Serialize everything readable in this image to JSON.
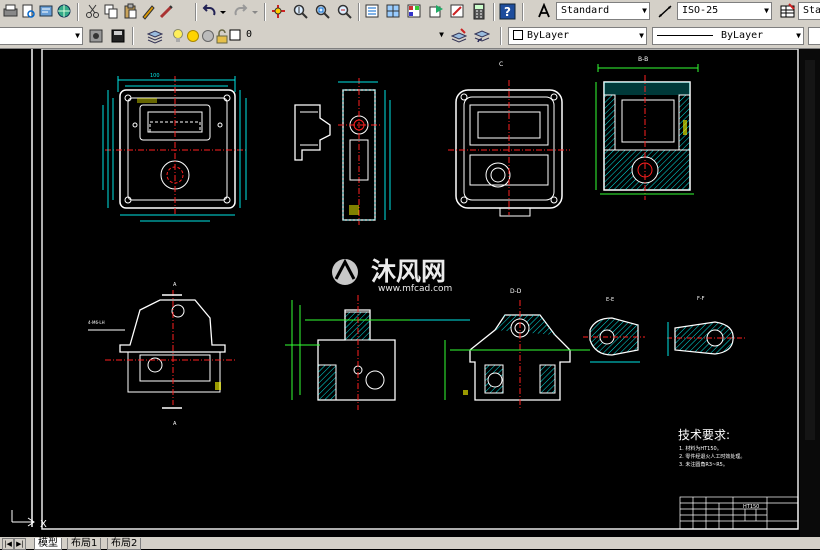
{
  "toolbar": {
    "text_style": "Standard",
    "dim_style": "ISO-25",
    "table_style_partial": "Sta"
  },
  "layers": {
    "current_layer": "0",
    "color": "ByLayer",
    "linetype": "ByLayer"
  },
  "drawing": {
    "views": {
      "top_right_label_c": "C",
      "top_right_label_bb": "B-B",
      "bottom_label_a_top": "A",
      "bottom_label_a_bottom": "A",
      "bottom_label_dd": "D-D",
      "bottom_label_ee": "E-E",
      "bottom_label_ff": "F-F",
      "hole_note": "4-M6-LH"
    },
    "watermark": {
      "brand": "沐风网",
      "url": "www.mfcad.com"
    },
    "tech_req": {
      "title": "技术要求:",
      "items": [
        "1. 材料为HT150。",
        "2. 零件经退火人工时效处理。",
        "3. 未注圆角R3~R5。"
      ]
    },
    "title_block": {
      "material": "HT150"
    }
  },
  "tabs": [
    "模型",
    "布局1",
    "布局2"
  ],
  "colors": {
    "drawing_cyan": "#00e5e5",
    "drawing_green": "#33ff33",
    "drawing_red": "#ff2020",
    "drawing_yellow": "#ffff00",
    "drawing_white": "#ffffff",
    "toolbar_bg": "#d4d0c8"
  }
}
